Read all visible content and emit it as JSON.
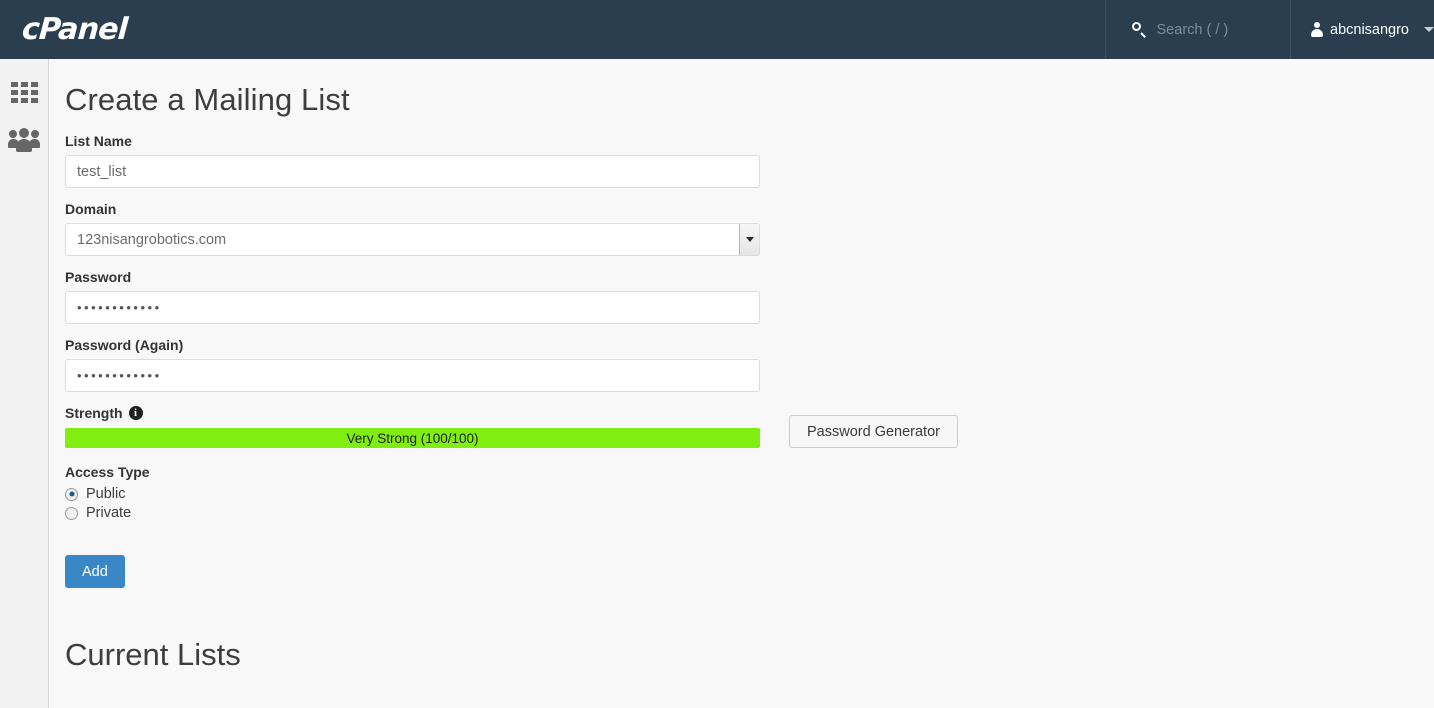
{
  "header": {
    "brand": "cPanel",
    "search": {
      "placeholder": "Search ( / )",
      "icon": "search-icon"
    },
    "user": {
      "name": "abcnisangro",
      "icon": "user-icon",
      "caret": "chevron-down-icon"
    }
  },
  "sidebar": {
    "items": [
      {
        "name": "tools-grid",
        "icon": "grid-icon"
      },
      {
        "name": "user-manager",
        "icon": "people-group-icon"
      }
    ]
  },
  "main": {
    "page_title": "Create a Mailing List",
    "fields": {
      "list_name": {
        "label": "List Name",
        "value": "test_list",
        "placeholder": "List Name"
      },
      "domain": {
        "label": "Domain",
        "value": "123nisangrobotics.com",
        "options": [
          "123nisangrobotics.com"
        ]
      },
      "password": {
        "label": "Password",
        "value": "••••••••••••"
      },
      "password_again": {
        "label": "Password (Again)",
        "value": "••••••••••••"
      },
      "strength": {
        "label": "Strength",
        "info_icon": "info-icon",
        "text": "Very Strong (100/100)",
        "score": 100,
        "max": 100,
        "bar_color": "#80ee10"
      },
      "access_type": {
        "label": "Access Type",
        "options": [
          {
            "label": "Public",
            "selected": true
          },
          {
            "label": "Private",
            "selected": false
          }
        ]
      }
    },
    "buttons": {
      "password_generator": "Password Generator",
      "add": "Add"
    },
    "current_lists_title": "Current Lists"
  },
  "colors": {
    "header_bg": "#2b3e50",
    "accent_blue": "#3a87c8",
    "strength_green": "#80ee10",
    "page_bg": "#f8f8f8",
    "sidebar_bg": "#f2f2f2"
  }
}
